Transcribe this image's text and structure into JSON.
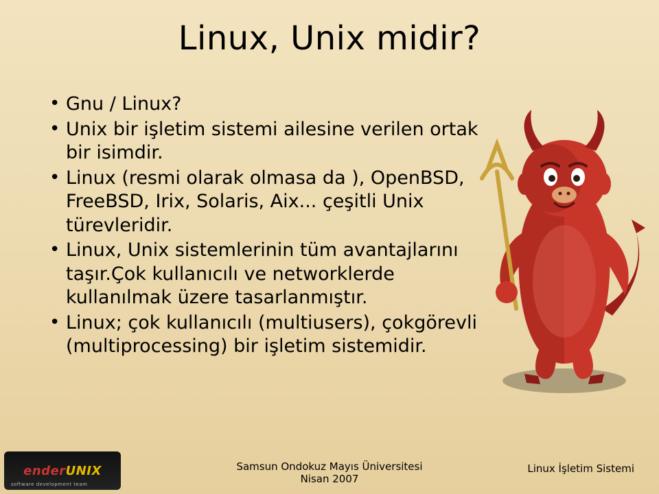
{
  "slide": {
    "title": "Linux, Unix midir?",
    "bullets": [
      "Gnu / Linux?",
      "Unix bir işletim sistemi ailesine verilen ortak bir isimdir.",
      "Linux (resmi olarak olmasa da ), OpenBSD, FreeBSD, Irix, Solaris, Aix... çeşitli Unix türevleridir.",
      "Linux, Unix sistemlerinin tüm avantajlarını taşır.Çok kullanıcılı ve networklerde kullanılmak üzere tasarlanmıştır.",
      "Linux; çok kullanıcılı (multiusers), çokgörevli (multiprocessing) bir işletim sistemidir."
    ]
  },
  "footer": {
    "logo_main": "enderUNIX",
    "logo_sub": "software development team",
    "center_line1": "Samsun Ondokuz Mayıs Üniversitesi",
    "center_line2": "Nisan 2007",
    "right": "Linux İşletim Sistemi"
  },
  "mascot": {
    "name": "bsd-daemon"
  }
}
